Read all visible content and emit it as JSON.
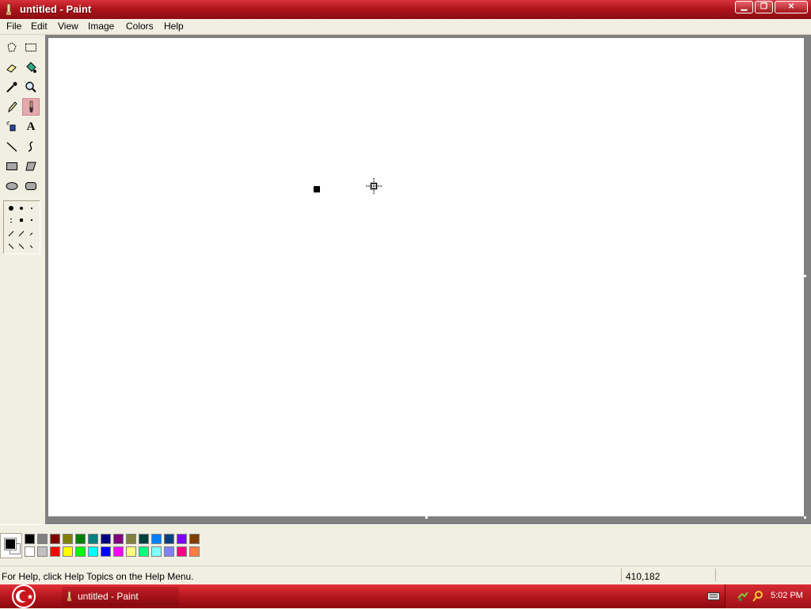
{
  "window": {
    "title": "untitled - Paint"
  },
  "menu": [
    "File",
    "Edit",
    "View",
    "Image",
    "Colors",
    "Help"
  ],
  "tools": [
    {
      "name": "free-select-icon"
    },
    {
      "name": "rect-select-icon"
    },
    {
      "name": "eraser-icon"
    },
    {
      "name": "fill-bucket-icon"
    },
    {
      "name": "color-picker-icon"
    },
    {
      "name": "magnifier-icon"
    },
    {
      "name": "pencil-icon"
    },
    {
      "name": "brush-icon"
    },
    {
      "name": "airbrush-icon"
    },
    {
      "name": "text-icon",
      "glyph": "A"
    },
    {
      "name": "line-icon"
    },
    {
      "name": "curve-icon"
    },
    {
      "name": "rectangle-icon"
    },
    {
      "name": "polygon-icon"
    },
    {
      "name": "ellipse-icon"
    },
    {
      "name": "rounded-rect-icon"
    }
  ],
  "selected_tool": "brush-icon",
  "palette": {
    "top": [
      "#000000",
      "#808080",
      "#800000",
      "#808000",
      "#008000",
      "#008080",
      "#000080",
      "#800080",
      "#808040",
      "#004040",
      "#0080ff",
      "#004080",
      "#8000ff",
      "#804000"
    ],
    "bottom": [
      "#ffffff",
      "#c0c0c0",
      "#ff0000",
      "#ffff00",
      "#00ff00",
      "#00ffff",
      "#0000ff",
      "#ff00ff",
      "#ffff80",
      "#00ff80",
      "#80ffff",
      "#8080ff",
      "#ff0080",
      "#ff8040"
    ],
    "foreground": "#000000",
    "background": "#ffffff"
  },
  "status": {
    "help_text": "For Help, click Help Topics on the Help Menu.",
    "coords": "410,182"
  },
  "taskbar": {
    "task_label": "untitled - Paint",
    "clock": "5:02 PM"
  }
}
